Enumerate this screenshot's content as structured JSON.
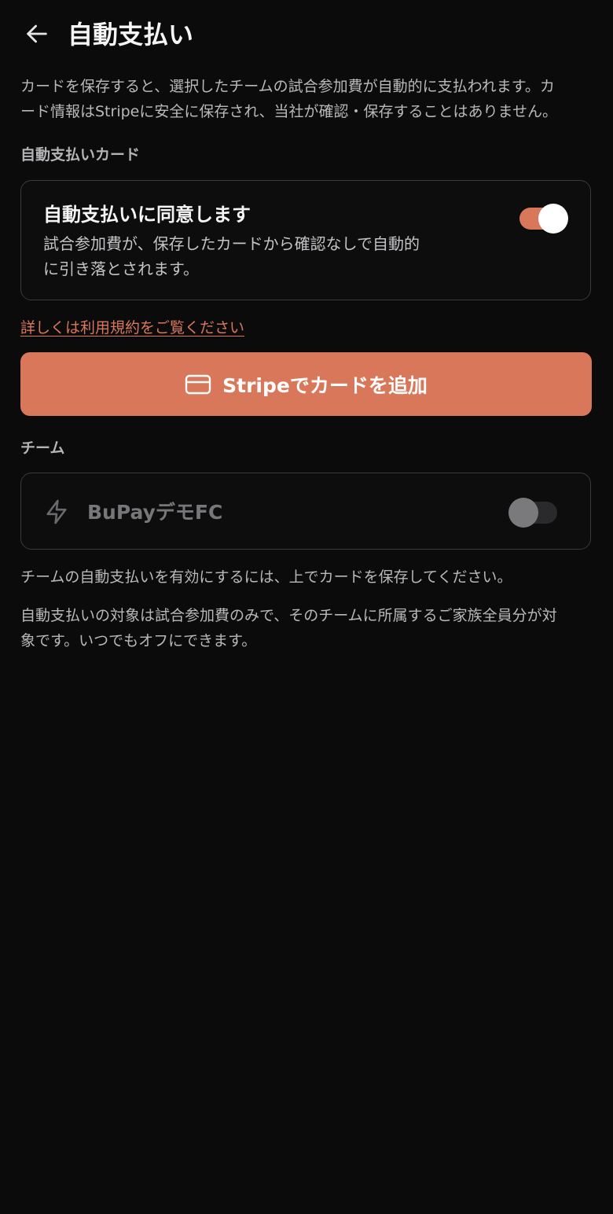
{
  "header": {
    "title": "自動支払い",
    "back_icon": "arrow-left-icon"
  },
  "intro": {
    "line1": "カードを保存すると、選択したチームの試合参加費が自動的に支払われます。カ",
    "line2": "ード情報はStripeに安全に保存され、当社が確認・保存することはありません。"
  },
  "auto_pay_card_section": {
    "label": "自動支払いカード",
    "consent": {
      "title": "自動支払いに同意します",
      "desc_line1": "試合参加費が、保存したカードから確認なしで自動的",
      "desc_line2": "に引き落とされます。",
      "toggle_on": true
    },
    "terms_link": "詳しくは利用規約をご覧ください",
    "add_card_button": {
      "label": "Stripeでカードを追加",
      "icon": "credit-card-icon"
    }
  },
  "team_section": {
    "label": "チーム",
    "teams": [
      {
        "name": "BuPayデモFC",
        "icon": "lightning-icon",
        "toggle_on": false
      }
    ],
    "note1": "チームの自動支払いを有効にするには、上でカードを保存してください。",
    "note2_line1": "自動支払いの対象は試合参加費のみで、そのチームに所属するご家族全員分が対",
    "note2_line2": "象です。いつでもオフにできます。"
  },
  "colors": {
    "accent": "#d9775a",
    "background": "#0b0b0c",
    "card_border": "#3a3a3d",
    "muted_text": "#b9b9bb"
  }
}
